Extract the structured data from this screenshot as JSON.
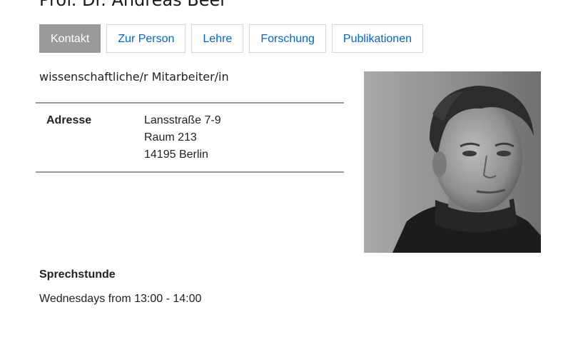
{
  "header": {
    "title": "Prof. Dr. Andreas Beer"
  },
  "tabs": [
    {
      "label": "Kontakt",
      "active": true
    },
    {
      "label": "Zur Person",
      "active": false
    },
    {
      "label": "Lehre",
      "active": false
    },
    {
      "label": "Forschung",
      "active": false
    },
    {
      "label": "Publikationen",
      "active": false
    }
  ],
  "profile": {
    "role": "wissenschaftliche/r Mitarbeiter/in"
  },
  "address": {
    "label": "Adresse",
    "lines": [
      "Lansstraße 7-9",
      "Raum 213",
      "14195 Berlin"
    ]
  },
  "office_hours": {
    "heading": "Sprechstunde",
    "text": "Wednesdays from 13:00 - 14:00"
  },
  "colors": {
    "link": "#0066cc",
    "active_tab_bg": "#9a9a9a",
    "rule": "#9a9a9a"
  }
}
